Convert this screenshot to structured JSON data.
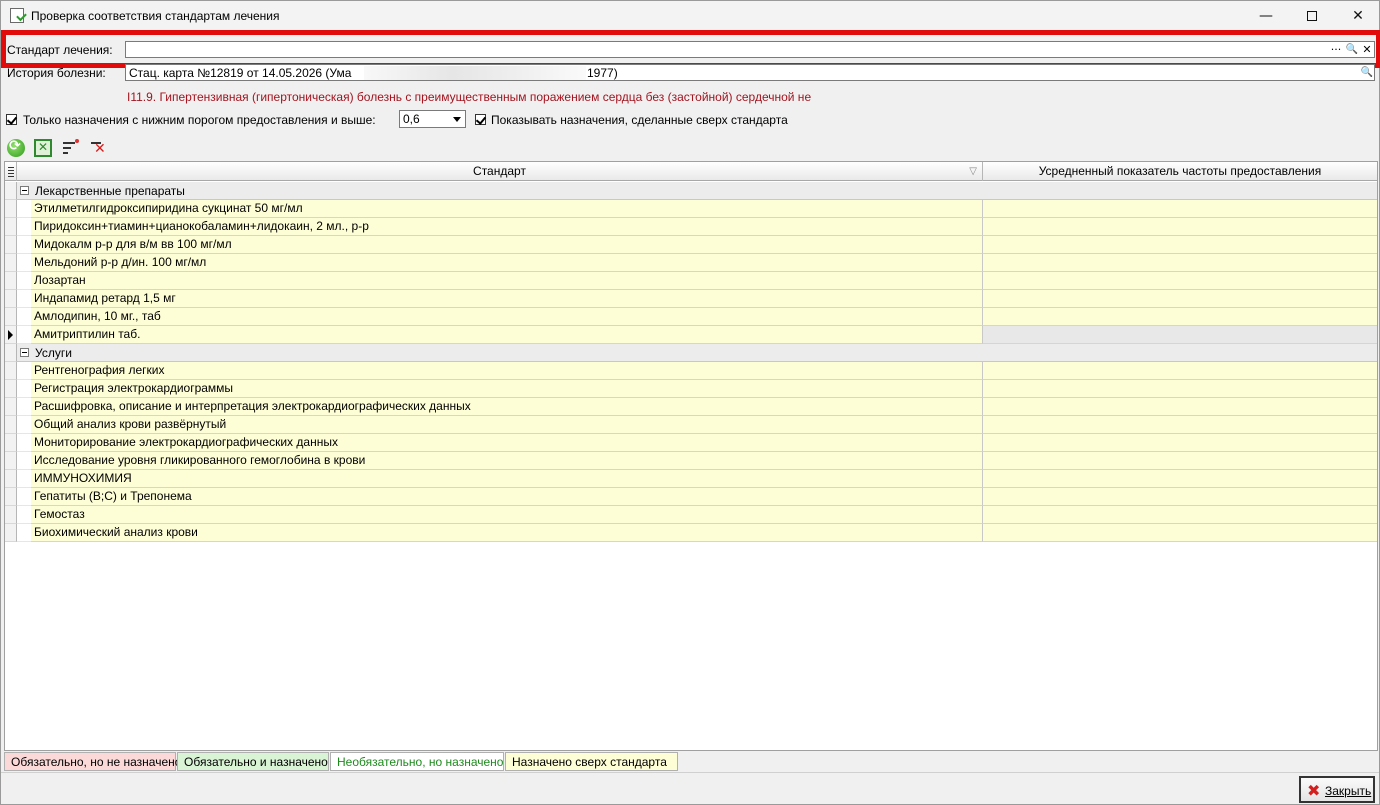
{
  "window": {
    "title": "Проверка соответствия стандартам лечения",
    "min_glyph": "—",
    "close_glyph": "✕"
  },
  "standard": {
    "label": "Стандарт лечения:",
    "value": "",
    "ellipsis_glyph": "···",
    "search_glyph": "🔍",
    "clear_glyph": "✕"
  },
  "history": {
    "label": "История болезни:",
    "value_prefix": "Стац. карта №12819 от 14.05.2026 (Ума",
    "value_suffix": "1977)",
    "search_glyph": "🔍"
  },
  "diagnosis": "I11.9. Гипертензивная (гипертоническая) болезнь с преимущественным поражением сердца без (застойной) сердечной не",
  "filters": {
    "threshold_label": "Только назначения с нижним порогом предоставления и выше:",
    "threshold_value": "0,6",
    "threshold_checked": true,
    "show_extra_label": "Показывать назначения, сделанные сверх стандарта",
    "show_extra_checked": true
  },
  "toolbar": {
    "icons": [
      "refresh-icon",
      "export-excel-icon",
      "filter-icon",
      "clear-filter-icon"
    ]
  },
  "grid": {
    "columns": [
      "Стандарт",
      "Усредненный показатель частоты предоставления"
    ],
    "sort_glyph": "▽",
    "groups": [
      {
        "label": "Лекарственные препараты",
        "rows": [
          "Этилметилгидроксипиридина сукцинат 50 мг/мл",
          "Пиридоксин+тиамин+цианокобаламин+лидокаин, 2 мл., р-р",
          "Мидокалм р-р для в/м вв 100 мг/мл",
          "Мельдоний р-р д/ин. 100 мг/мл",
          "Лозартан",
          "Индапамид ретард 1,5 мг",
          "Амлодипин, 10 мг., таб",
          "Амитриптилин таб."
        ],
        "current_row": 7
      },
      {
        "label": "Услуги",
        "rows": [
          "Рентгенография легких",
          "Регистрация электрокардиограммы",
          "Расшифровка, описание и интерпретация электрокардиографических данных",
          "Общий анализ крови развёрнутый",
          "Мониторирование электрокардиографических данных",
          "Исследование уровня гликированного гемоглобина в крови",
          "ИММУНОХИМИЯ",
          "Гепатиты (В;С) и Трепонема",
          "Гемостаз",
          "Биохимический анализ крови"
        ]
      }
    ]
  },
  "legend": [
    "Обязательно, но не назначено",
    "Обязательно и назначено",
    "Необязательно, но назначено",
    "Назначено сверх стандарта"
  ],
  "legend_colors": [
    "#fbd9d9",
    "#d9f3d5",
    "#ffffff",
    "#fefed6"
  ],
  "buttons": {
    "close_label": "Закрыть"
  },
  "colors": {
    "highlight_border": "#e20b0b",
    "diagnosis_text": "#a3141f",
    "row_fill": "#fefed6"
  }
}
